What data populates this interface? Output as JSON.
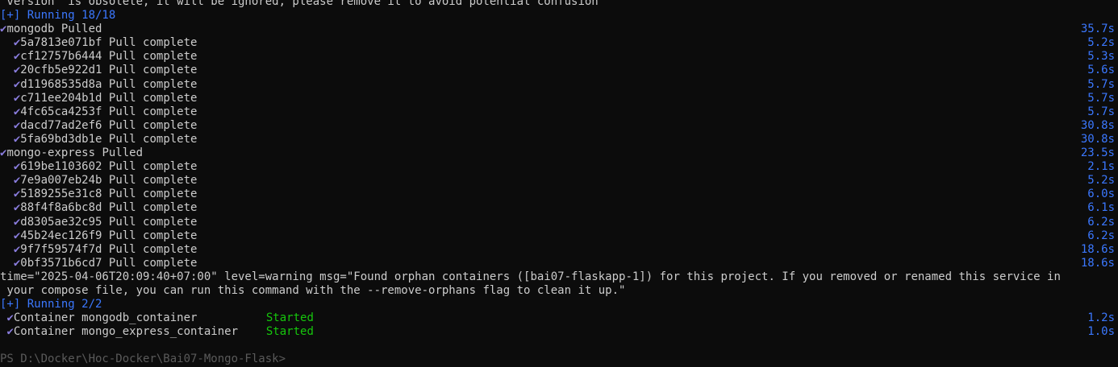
{
  "colors": {
    "background": "#0c0c0c",
    "text": "#cccccc",
    "blue": "#3b78ff",
    "green": "#16c60c",
    "check": "#8a7dde"
  },
  "check_glyph": "✔",
  "warning_line": "`version` is obsolete, it will be ignored, please remove it to avoid potential confusion\"",
  "running1": "[+] Running 18/18",
  "mongodb": {
    "label": "mongodb Pulled",
    "duration": "35.7s"
  },
  "mongodb_layers": [
    {
      "id": "5a7813e071bf",
      "status": "Pull complete",
      "duration": "5.2s"
    },
    {
      "id": "cf12757b6444",
      "status": "Pull complete",
      "duration": "5.3s"
    },
    {
      "id": "20cfb5e922d1",
      "status": "Pull complete",
      "duration": "5.6s"
    },
    {
      "id": "d11968535d8a",
      "status": "Pull complete",
      "duration": "5.7s"
    },
    {
      "id": "c711ee204b1d",
      "status": "Pull complete",
      "duration": "5.7s"
    },
    {
      "id": "4fc65ca4253f",
      "status": "Pull complete",
      "duration": "5.7s"
    },
    {
      "id": "dacd77ad2ef6",
      "status": "Pull complete",
      "duration": "30.8s"
    },
    {
      "id": "5fa69bd3db1e",
      "status": "Pull complete",
      "duration": "30.8s"
    }
  ],
  "mongo_express": {
    "label": "mongo-express Pulled",
    "duration": "23.5s"
  },
  "mongo_express_layers": [
    {
      "id": "619be1103602",
      "status": "Pull complete",
      "duration": "2.1s"
    },
    {
      "id": "7e9a007eb24b",
      "status": "Pull complete",
      "duration": "5.2s"
    },
    {
      "id": "5189255e31c8",
      "status": "Pull complete",
      "duration": "6.0s"
    },
    {
      "id": "88f4f8a6bc8d",
      "status": "Pull complete",
      "duration": "6.1s"
    },
    {
      "id": "d8305ae32c95",
      "status": "Pull complete",
      "duration": "6.2s"
    },
    {
      "id": "45b24ec126f9",
      "status": "Pull complete",
      "duration": "6.2s"
    },
    {
      "id": "9f7f59574f7d",
      "status": "Pull complete",
      "duration": "18.6s"
    },
    {
      "id": "0bf3571b6cd7",
      "status": "Pull complete",
      "duration": "18.6s"
    }
  ],
  "orphan_line1": "time=\"2025-04-06T20:09:40+07:00\" level=warning msg=\"Found orphan containers ([bai07-flaskapp-1]) for this project. If you removed or renamed this service in",
  "orphan_line2": " your compose file, you can run this command with the --remove-orphans flag to clean it up.\"",
  "running2": "[+] Running 2/2",
  "containers": [
    {
      "label": "Container mongodb_container",
      "status": "Started",
      "duration": "1.2s"
    },
    {
      "label": "Container mongo_express_container",
      "status": "Started",
      "duration": "1.0s"
    }
  ],
  "prompt_partial": "PS D:\\Docker\\Hoc-Docker\\Bai07-Mongo-Flask> "
}
